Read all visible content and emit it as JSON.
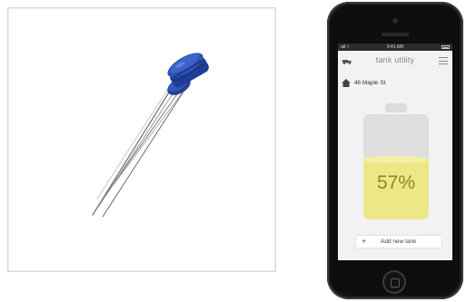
{
  "phone": {
    "status_bar": {
      "carrier": "atl ≈",
      "time": "9:41 AM"
    },
    "app": {
      "title": "tank utility",
      "address": "48 Maple St",
      "tank_level_percent": 57,
      "tank_level_label": "57%",
      "add_button_label": "Add new tank",
      "add_button_icon": "plus-icon"
    }
  },
  "colors": {
    "tank_fill": "#ece887",
    "tank_empty": "#dedede",
    "percent_text": "#8c8720",
    "sensor_cap": "#2a49a8"
  }
}
